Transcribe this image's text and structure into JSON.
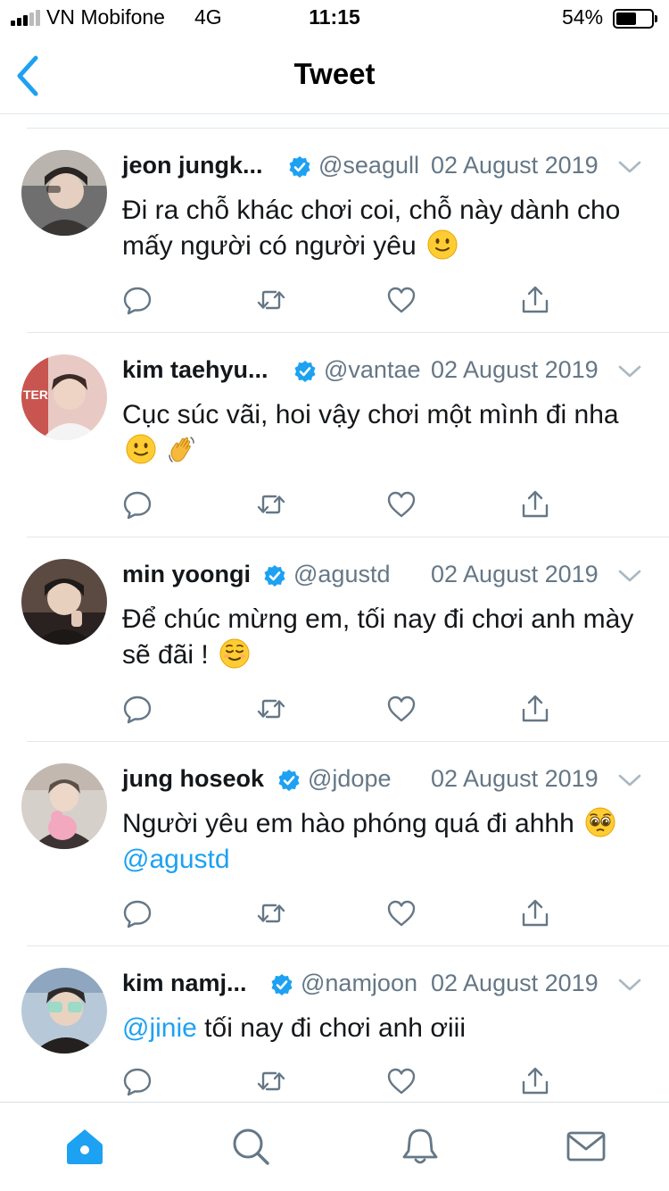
{
  "status_bar": {
    "carrier": "VN Mobifone",
    "network": "4G",
    "time": "11:15",
    "battery": "54%",
    "battery_level": 0.54
  },
  "nav": {
    "title": "Tweet",
    "back_icon": "chevron-left-icon",
    "accent_color": "#1da1f2"
  },
  "tweets": [
    {
      "name": "jeon jungk...",
      "handle": "@seagull",
      "date": "02 August 2019",
      "text": "Đi ra chỗ khác chơi coi, chỗ này dành cho mấy người có người yêu",
      "emojis": [
        "slightly-smiling-face"
      ]
    },
    {
      "name": "kim taehyu...",
      "handle": "@vantae",
      "date": "02 August 2019",
      "text": "Cục súc vãi, hoi vậy chơi một mình đi nha",
      "emojis": [
        "slightly-smiling-face",
        "waving-hand"
      ]
    },
    {
      "name": "min yoongi",
      "handle": "@agustd",
      "date": "02 August 2019",
      "text": "Để chúc mừng em, tối nay đi chơi anh mày sẽ đãi !",
      "emojis": [
        "relieved-face"
      ]
    },
    {
      "name": "jung hoseok",
      "handle": "@jdope",
      "date": "02 August 2019",
      "text": "Người yêu em hào phóng quá đi ahhh",
      "emojis": [
        "pleading-face"
      ],
      "mention_after": "@agustd"
    },
    {
      "name": "kim namj...",
      "handle": "@namjoon",
      "date": "02 August 2019",
      "mention_before": "@jinie",
      "text": "tối nay đi chơi anh ơiii",
      "emojis": []
    }
  ],
  "tweet_actions": [
    "reply-icon",
    "retweet-icon",
    "like-icon",
    "share-icon"
  ],
  "tab_bar": {
    "tabs": [
      "home-icon",
      "search-icon",
      "notifications-icon",
      "messages-icon"
    ],
    "active": "home-icon"
  },
  "colors": {
    "text": "#14171a",
    "secondary": "#657786",
    "verified": "#1da1f2",
    "divider": "#e1e8ed"
  }
}
